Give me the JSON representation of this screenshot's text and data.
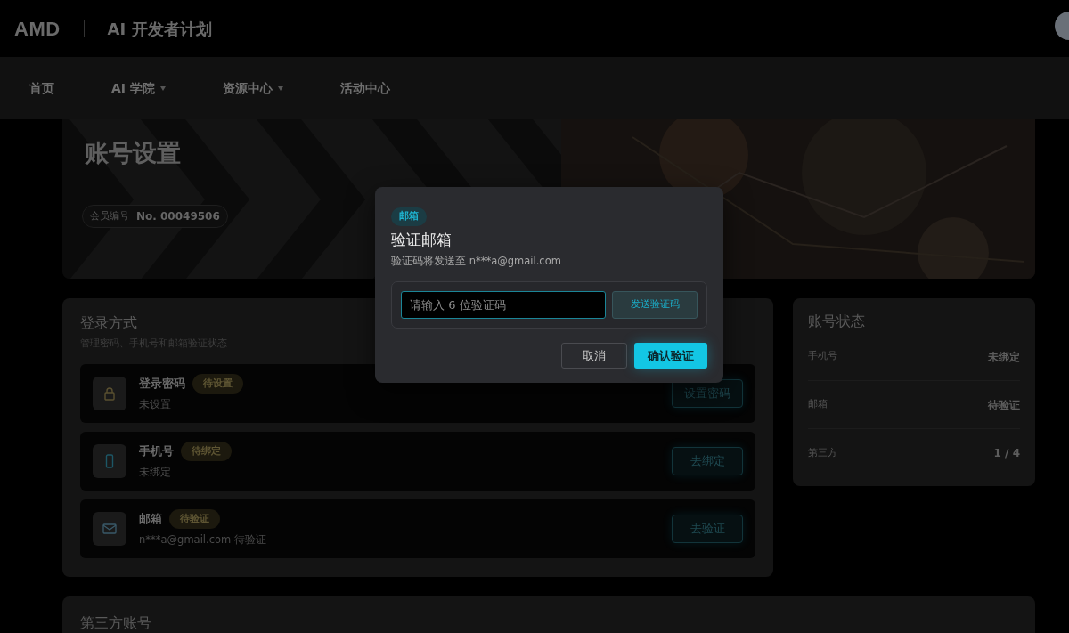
{
  "header": {
    "logo": "AMD",
    "title": "AI 开发者计划"
  },
  "nav": [
    {
      "label": "首页",
      "dropdown": false
    },
    {
      "label": "AI 学院",
      "dropdown": true
    },
    {
      "label": "资源中心",
      "dropdown": true
    },
    {
      "label": "活动中心",
      "dropdown": false
    }
  ],
  "hero": {
    "title": "账号设置",
    "member_label": "会员编号",
    "member_no": "No. 00049506"
  },
  "login_methods": {
    "title": "登录方式",
    "subtitle": "管理密码、手机号和邮箱验证状态",
    "items": [
      {
        "kind": "password",
        "name": "登录密码",
        "status": "待设置",
        "detail": "未设置",
        "action": "设置密码"
      },
      {
        "kind": "phone",
        "name": "手机号",
        "status": "待绑定",
        "detail": "未绑定",
        "action": "去绑定"
      },
      {
        "kind": "email",
        "name": "邮箱",
        "status": "待验证",
        "detail": "n***a@gmail.com 待验证",
        "action": "去验证"
      }
    ]
  },
  "account_status": {
    "title": "账号状态",
    "rows": [
      {
        "label": "手机号",
        "value": "未绑定"
      },
      {
        "label": "邮箱",
        "value": "待验证"
      },
      {
        "label": "第三方",
        "value": "1 / 4"
      }
    ]
  },
  "third_party": {
    "title": "第三方账号"
  },
  "modal": {
    "tag": "邮箱",
    "title": "验证邮箱",
    "description": "验证码将发送至 n***a@gmail.com",
    "placeholder": "请输入 6 位验证码",
    "send_button": "发送验证码",
    "cancel": "取消",
    "confirm": "确认验证"
  }
}
